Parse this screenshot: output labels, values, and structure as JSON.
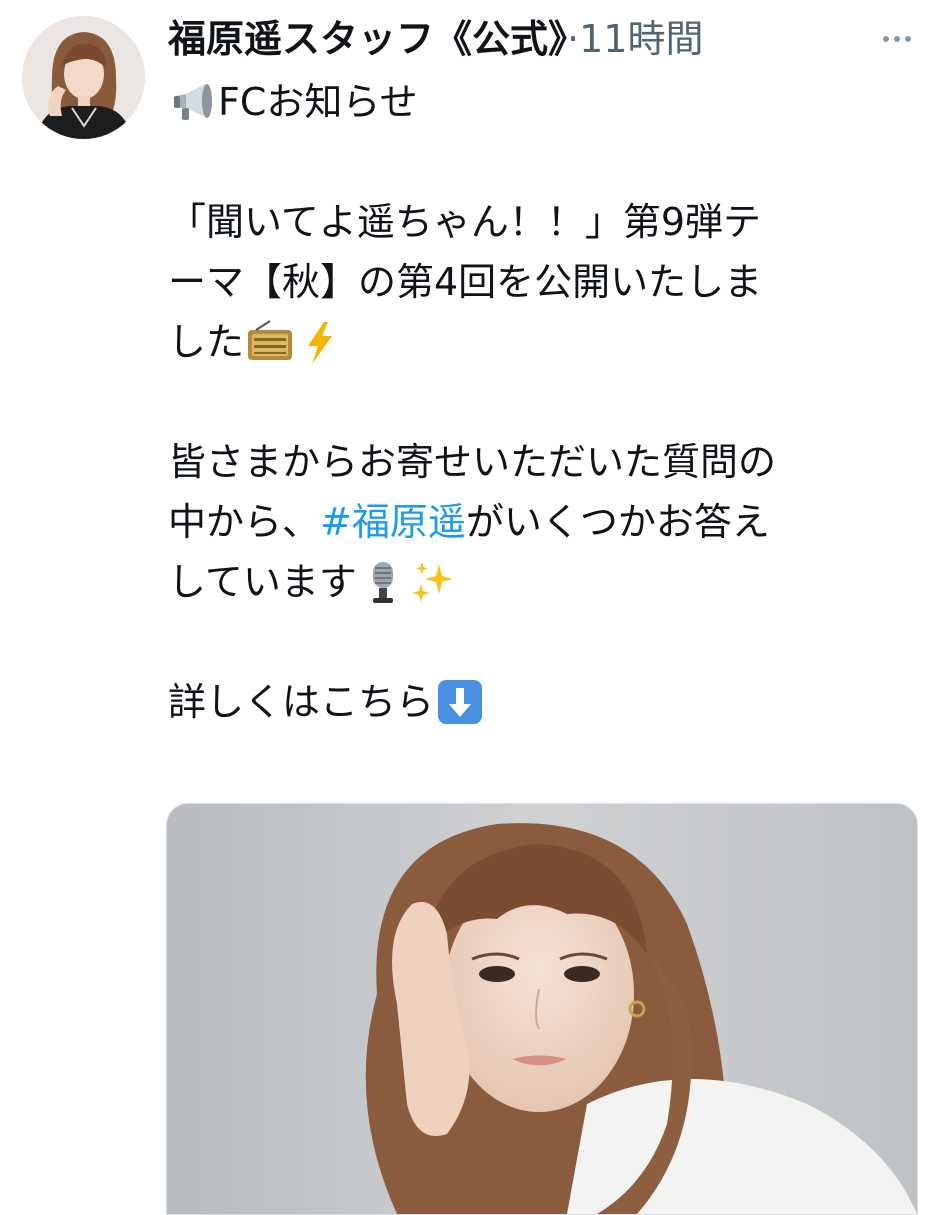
{
  "tweet": {
    "author_name": "福原遥スタッフ《公式》",
    "separator": "·",
    "time": "11時間",
    "more_icon": "more-horizontal-icon",
    "lines": {
      "l1": "FCお知らせ",
      "l2": "「聞いてよ遥ちゃん！！」第9弾テ",
      "l3": "ーマ【秋】の第4回を公開いたしま",
      "l4": "した",
      "l5": "皆さまからお寄せいただいた質問の",
      "l6a": "中から、",
      "l6_hashtag": "#福原遥",
      "l6b": " がいくつかお答え",
      "l7": "しています",
      "l8": "詳しくはこちら"
    },
    "emojis": [
      "loudspeaker-icon",
      "radio-icon",
      "lightning-icon",
      "microphone-icon",
      "sparkles-icon",
      "down-arrow-icon"
    ]
  },
  "colors": {
    "text": "#0f1419",
    "secondary": "#536471",
    "link": "#1d9bf0"
  }
}
